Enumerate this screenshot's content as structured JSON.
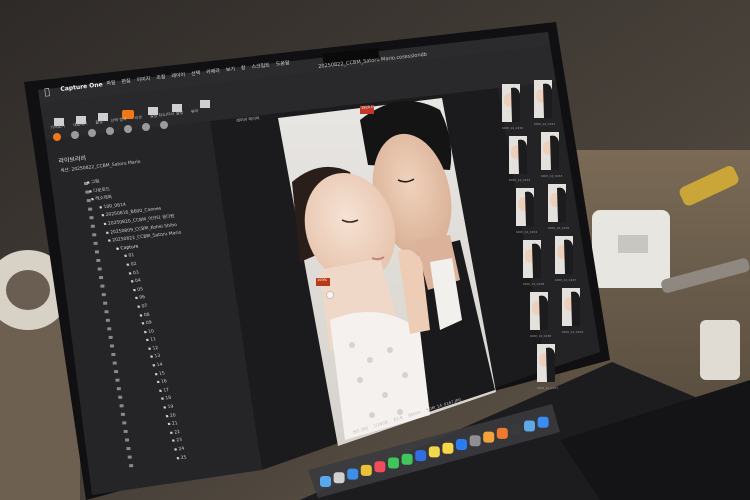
{
  "menubar": {
    "app_name": "Capture One",
    "menus": [
      "파일",
      "편집",
      "이미지",
      "조정",
      "레이어",
      "선택",
      "카메라",
      "보기",
      "창",
      "스크립트",
      "도움말"
    ]
  },
  "window": {
    "title": "20250822_CCBM_Satoru Mario.cosessiondb"
  },
  "toolbar": {
    "labels": [
      "가져오기",
      "내보내기",
      "촬영",
      "선택 항목",
      "리셋",
      "실행 취소/다시 실행",
      "뷰어"
    ]
  },
  "sidebar": {
    "header": "라이브러리",
    "session_label": "세션: 20250822_CCBM_Satoru Mario",
    "top_items": [
      "그림",
      "다운로드",
      "레소제화"
    ],
    "folders": [
      "100_0614",
      "20250816_B600_Cannes",
      "20250820_CCBM_이카타 공다원",
      "20250809_CCBM_Kohei Shiho",
      "20250822_CCBM_Satoru Mario"
    ],
    "capture_label": "Capture",
    "subfolders": [
      "01",
      "02",
      "03",
      "04",
      "05",
      "06",
      "07",
      "08",
      "09",
      "10",
      "11",
      "12",
      "13",
      "14",
      "15",
      "16",
      "17",
      "18",
      "19",
      "20",
      "21",
      "22",
      "23",
      "24",
      "25"
    ]
  },
  "viewer": {
    "tab_label": "레이어 레이어",
    "image_tag": "1920 D",
    "face_tag": "100%",
    "status": [
      "ISO 200",
      "1/160초",
      "f/2.8",
      "85mm",
      "KDM_14_0167.JPG"
    ]
  },
  "browser": {
    "thumbnails": [
      "KDM_14_0150",
      "KDM_14_0151",
      "KDM_14_0152",
      "KDM_14_0153",
      "KDM_14_0154",
      "KDM_14_0155",
      "KDM_14_0156",
      "KDM_14_0157",
      "KDM_14_0158",
      "KDM_14_0159",
      "KDM_14_0167"
    ]
  },
  "dock": {
    "apps": [
      "finder-icon",
      "launchpad-icon",
      "safari-icon",
      "chrome-icon",
      "music-icon",
      "facetime-icon",
      "messages-icon",
      "info-icon",
      "notes-icon",
      "kakaotalk-icon",
      "appstore-icon",
      "settings-icon",
      "photos-icon",
      "firefox-icon",
      "capture-one-icon",
      "preview-icon",
      "mail-icon"
    ]
  },
  "colors": {
    "accent": "#f07818",
    "screen_bg": "#1f1f21",
    "panel_bg": "#262628"
  }
}
